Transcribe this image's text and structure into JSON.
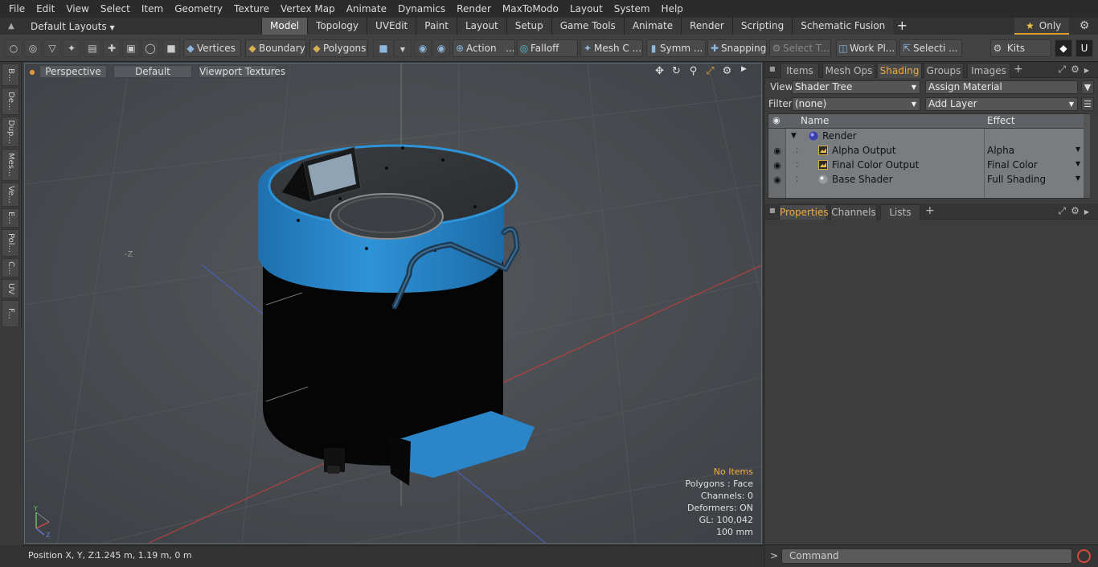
{
  "menu": [
    "File",
    "Edit",
    "View",
    "Select",
    "Item",
    "Geometry",
    "Texture",
    "Vertex Map",
    "Animate",
    "Dynamics",
    "Render",
    "MaxToModo",
    "Layout",
    "System",
    "Help"
  ],
  "layoutbar": {
    "layouts_label": "Default Layouts",
    "tabs": [
      {
        "label": "Model",
        "active": true
      },
      {
        "label": "Topology",
        "active": false
      },
      {
        "label": "UVEdit",
        "active": false
      },
      {
        "label": "Paint",
        "active": false
      },
      {
        "label": "Layout",
        "active": false
      },
      {
        "label": "Setup",
        "active": false
      },
      {
        "label": "Game Tools",
        "active": false
      },
      {
        "label": "Animate",
        "active": false
      },
      {
        "label": "Render",
        "active": false
      },
      {
        "label": "Scripting",
        "active": false
      },
      {
        "label": "Schematic Fusion",
        "active": false
      }
    ],
    "plus_label": "+",
    "only_label": "Only"
  },
  "toolbar": {
    "vertices": "Vertices",
    "boundary": "Boundary",
    "polygons": "Polygons",
    "action": "Action",
    "action_more": "...",
    "falloff": "Falloff",
    "mesh": "Mesh C ...",
    "symm": "Symm ...",
    "snapping": "Snapping",
    "select_t": "Select T...",
    "work_pl": "Work Pl...",
    "selecti": "Selecti ...",
    "kits": "Kits"
  },
  "lefttabs": [
    "B...",
    "De...",
    "Dup...",
    "Mes...",
    "Ve...",
    "E...",
    "Pol...",
    "C...",
    "UV",
    "F..."
  ],
  "viewport": {
    "view_mode": "Perspective",
    "shading": "Default",
    "textures": "Viewport Textures",
    "axis_label_z": "-Z",
    "gizmo": {
      "x": "X",
      "y": "Y",
      "z": "Z"
    },
    "info": {
      "selection": "No Items",
      "polygons": "Polygons : Face",
      "channels": "Channels: 0",
      "deformers": "Deformers: ON",
      "gl": "GL: 100,042",
      "units": "100 mm"
    }
  },
  "status": {
    "position_label": "Position X, Y, Z:",
    "position_value": "1.245 m, 1.19 m, 0 m"
  },
  "rightpanel": {
    "top_tabs": [
      {
        "label": "Items",
        "active": false
      },
      {
        "label": "Mesh Ops",
        "active": false
      },
      {
        "label": "Shading",
        "active": true
      },
      {
        "label": "Groups",
        "active": false
      },
      {
        "label": "Images",
        "active": false
      }
    ],
    "view_label": "View",
    "view_value": "Shader Tree",
    "assign_material": "Assign Material",
    "filter_label": "Filter",
    "filter_value": "(none)",
    "add_layer": "Add Layer",
    "tree_header": {
      "name": "Name",
      "effect": "Effect"
    },
    "tree_rows": [
      {
        "name": "Render",
        "effect": ""
      },
      {
        "name": "Alpha Output",
        "effect": "Alpha"
      },
      {
        "name": "Final Color Output",
        "effect": "Final Color"
      },
      {
        "name": "Base Shader",
        "effect": "Full Shading"
      }
    ],
    "bottom_tabs": [
      {
        "label": "Properties",
        "active": true
      },
      {
        "label": "Channels",
        "active": false
      },
      {
        "label": "Lists",
        "active": false
      }
    ],
    "command_placeholder": "Command",
    "prompt": ">"
  },
  "colors": {
    "accent": "#f0a840",
    "pot_blue": "#2a86c9",
    "viewport_bg": "#484b4f"
  }
}
